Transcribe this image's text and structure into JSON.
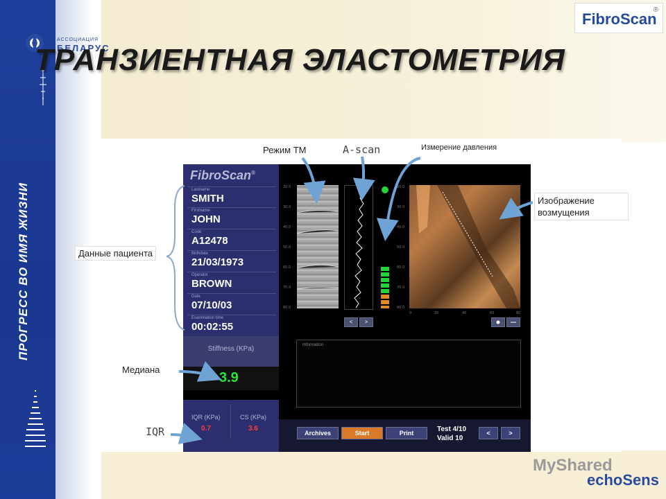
{
  "slide": {
    "title": "ТРАНЗИЕНТНАЯ ЭЛАСТОМЕТРИЯ",
    "side_slogan": "ПРОГРЕСС ВО ИМЯ ЖИЗНИ",
    "assoc_small": "АССОЦИАЦИЯ",
    "assoc_big": "БЕЛАРУС",
    "brand_logo": "FibroScan",
    "brand_logo_mark": "®"
  },
  "annotations": {
    "tm_mode": "Режим ТМ",
    "ascan": "A-scan",
    "pressure": "Измерение давления",
    "wave_image": "Изображение возмущения",
    "patient_data": "Данные пациента",
    "median": "Медиана",
    "iqr": "IQR"
  },
  "device": {
    "logo": "FibroScan",
    "logo_mark": "®",
    "fields": [
      {
        "label": "Lastname",
        "value": "SMITH"
      },
      {
        "label": "Firstname",
        "value": "JOHN"
      },
      {
        "label": "Code",
        "value": "A12478"
      },
      {
        "label": "Birthdate",
        "value": "21/03/1973"
      },
      {
        "label": "Operator",
        "value": "BROWN"
      },
      {
        "label": "Date",
        "value": "07/10/03"
      },
      {
        "label": "Examination time",
        "value": "00:02:55"
      }
    ],
    "stiffness_label": "Stiffness (KPa)",
    "median_value": "3.9",
    "iqr_label": "IQR (KPa)",
    "iqr_value": "0.7",
    "cs_label": "CS (KPa)",
    "cs_value": "3.6",
    "information_label": "Information",
    "buttons": {
      "archives": "Archives",
      "start": "Start",
      "print": "Print",
      "prev": "<",
      "next": ">"
    },
    "test_label": "Test",
    "test_value": "4/10",
    "valid_label": "Valid",
    "valid_value": "10",
    "colors": {
      "panel": "#2b2f6d",
      "median_green": "#2be33b",
      "iqr_red": "#ff3b3b",
      "start_orange": "#d97a2a",
      "pressure_green": "#25d33a",
      "pressure_orange": "#e08a2a"
    },
    "pressure_level": {
      "green_bars": 5,
      "orange_bars": 3
    }
  },
  "footer": {
    "watermark": "MyShared",
    "echosens": "echoSens"
  }
}
